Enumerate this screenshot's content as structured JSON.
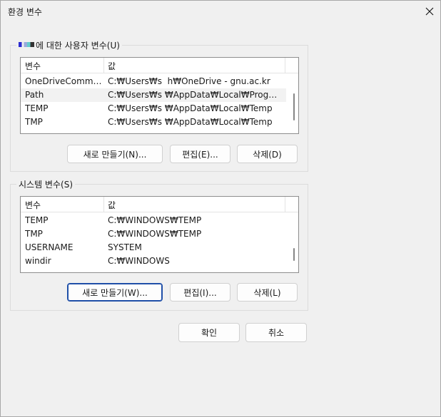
{
  "window": {
    "title": "환경 변수"
  },
  "user_group": {
    "legend_suffix": "에 대한 사용자 변수(U)",
    "columns": [
      "변수",
      "값"
    ],
    "rows": [
      {
        "name": "OneDriveCommer...",
        "value": "C:₩Users₩s  ⁠ h₩OneDrive - gnu.ac.kr"
      },
      {
        "name": "Path",
        "value": "C:₩Users₩s    ₩AppData₩Local₩Progra..."
      },
      {
        "name": "TEMP",
        "value": "C:₩Users₩s    ₩AppData₩Local₩Temp"
      },
      {
        "name": "TMP",
        "value": "C:₩Users₩s    ₩AppData₩Local₩Temp"
      }
    ],
    "selected_index": 1,
    "buttons": {
      "new": "새로 만들기(N)...",
      "edit": "편집(E)...",
      "delete": "삭제(D)"
    }
  },
  "system_group": {
    "legend": "시스템 변수(S)",
    "columns": [
      "변수",
      "값"
    ],
    "rows": [
      {
        "name": "TEMP",
        "value": "C:₩WINDOWS₩TEMP"
      },
      {
        "name": "TMP",
        "value": "C:₩WINDOWS₩TEMP"
      },
      {
        "name": "USERNAME",
        "value": "SYSTEM"
      },
      {
        "name": "windir",
        "value": "C:₩WINDOWS"
      }
    ],
    "buttons": {
      "new": "새로 만들기(W)...",
      "edit": "편집(I)...",
      "delete": "삭제(L)"
    }
  },
  "footer": {
    "ok": "확인",
    "cancel": "취소"
  }
}
